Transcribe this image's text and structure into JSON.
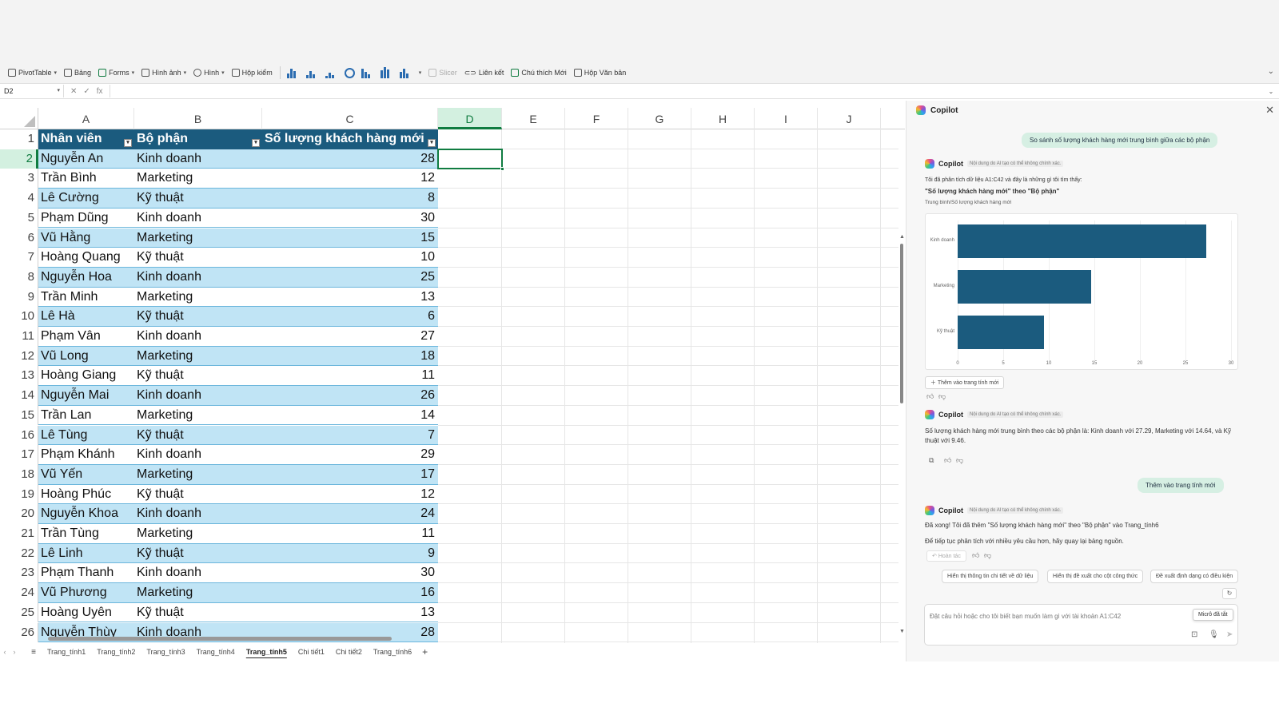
{
  "ribbon": {
    "items": [
      "PivotTable",
      "Bảng",
      "Forms",
      "Hình ảnh",
      "Hình",
      "Hộp kiểm"
    ],
    "items2": [
      "Slicer",
      "Liên kết",
      "Chú thích Mới",
      "Hộp Văn bản"
    ]
  },
  "formula_bar": {
    "name_box": "D2",
    "fx": "fx",
    "formula": ""
  },
  "grid": {
    "columns": [
      "A",
      "B",
      "C",
      "D",
      "E",
      "F",
      "G",
      "H",
      "I",
      "J"
    ],
    "selected_column": "D",
    "selected_row": 2,
    "header_row": [
      "Nhân viên",
      "Bộ phận",
      "Số lượng khách hàng mới"
    ],
    "rows": [
      [
        "Nguyễn An",
        "Kinh doanh",
        "28"
      ],
      [
        "Trần Bình",
        "Marketing",
        "12"
      ],
      [
        "Lê Cường",
        "Kỹ thuật",
        "8"
      ],
      [
        "Phạm Dũng",
        "Kinh doanh",
        "30"
      ],
      [
        "Vũ Hằng",
        "Marketing",
        "15"
      ],
      [
        "Hoàng Quang",
        "Kỹ thuật",
        "10"
      ],
      [
        "Nguyễn Hoa",
        "Kinh doanh",
        "25"
      ],
      [
        "Trần Minh",
        "Marketing",
        "13"
      ],
      [
        "Lê Hà",
        "Kỹ thuật",
        "6"
      ],
      [
        "Phạm Vân",
        "Kinh doanh",
        "27"
      ],
      [
        "Vũ Long",
        "Marketing",
        "18"
      ],
      [
        "Hoàng Giang",
        "Kỹ thuật",
        "11"
      ],
      [
        "Nguyễn Mai",
        "Kinh doanh",
        "26"
      ],
      [
        "Trần Lan",
        "Marketing",
        "14"
      ],
      [
        "Lê Tùng",
        "Kỹ thuật",
        "7"
      ],
      [
        "Phạm Khánh",
        "Kinh doanh",
        "29"
      ],
      [
        "Vũ Yến",
        "Marketing",
        "17"
      ],
      [
        "Hoàng Phúc",
        "Kỹ thuật",
        "12"
      ],
      [
        "Nguyễn Khoa",
        "Kinh doanh",
        "24"
      ],
      [
        "Trần Tùng",
        "Marketing",
        "11"
      ],
      [
        "Lê Linh",
        "Kỹ thuật",
        "9"
      ],
      [
        "Phạm Thanh",
        "Kinh doanh",
        "30"
      ],
      [
        "Vũ Phương",
        "Marketing",
        "16"
      ],
      [
        "Hoàng Uyên",
        "Kỹ thuật",
        "13"
      ],
      [
        "Nguyễn Thùy",
        "Kinh doanh",
        "28"
      ]
    ]
  },
  "sheet_tabs": [
    "Trang_tính1",
    "Trang_tính2",
    "Trang_tính3",
    "Trang_tính4",
    "Trang_tính5",
    "Chi tiết1",
    "Chi tiết2",
    "Trang_tính6"
  ],
  "active_sheet": "Trang_tính5",
  "copilot": {
    "title": "Copilot",
    "close": "✕",
    "user_msg_1": "So sánh số lượng khách hàng mới trung bình giữa các bộ phận",
    "bot_name": "Copilot",
    "disclaimer": "Nội dung do AI tạo có thể không chính xác.",
    "resp1_intro": "Tôi đã phân tích dữ liệu A1:C42 và đây là những gì tôi tìm thấy:",
    "resp1_chart_title": "\"Số lượng khách hàng mới\" theo \"Bộ phận\"",
    "resp1_chart_subtitle": "Trung bình/Số lượng khách hàng mới",
    "add_to_sheet_btn": "Thêm vào trang tính mới",
    "resp2_text": "Số lượng khách hàng mới trung bình theo các bộ phận là: Kinh doanh với 27.29, Marketing với 14.64, và Kỹ thuật với 9.46.",
    "user_msg_2": "Thêm vào trang tính mới",
    "resp3_line1": "Đã xong! Tôi đã thêm \"Số lượng khách hàng mới\" theo \"Bộ phận\" vào Trang_tính6",
    "resp3_line2": "Để tiếp tục phân tích với nhiều yêu cầu hơn, hãy quay lại bảng nguồn.",
    "undo": "Hoàn tác",
    "suggestions": [
      "Hiển thị thông tin chi tiết về dữ liệu",
      "Hiển thị đề xuất cho cột công thức",
      "Đề xuất định dạng có điều kiện"
    ],
    "input_placeholder": "Đặt câu hỏi hoặc cho tôi biết bạn muốn làm gì với tài khoản A1:C42",
    "mic_tooltip": "Micrô đã tắt"
  },
  "chart_data": {
    "type": "bar",
    "orientation": "horizontal",
    "categories": [
      "Kinh doanh",
      "Marketing",
      "Kỹ thuật"
    ],
    "values": [
      27.29,
      14.64,
      9.46
    ],
    "xticks": [
      "0",
      "5",
      "10",
      "15",
      "20",
      "25",
      "30"
    ],
    "xlim": [
      0,
      30
    ],
    "color": "#1b5b7e"
  }
}
